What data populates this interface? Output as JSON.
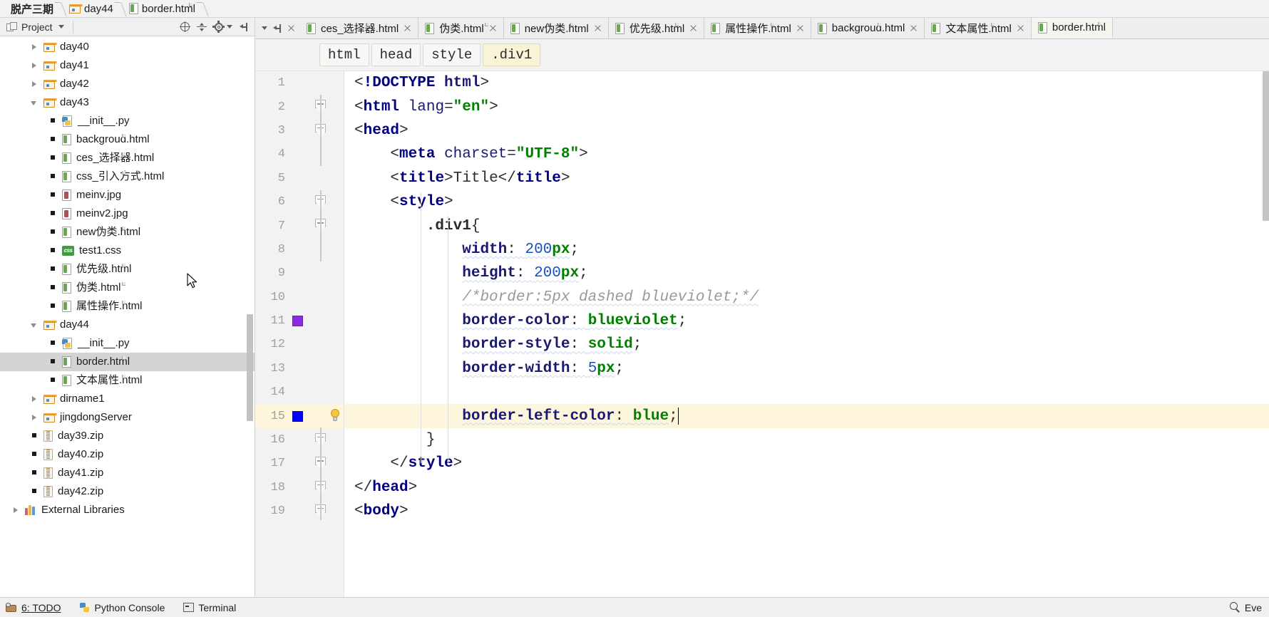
{
  "breadcrumb": {
    "items": [
      {
        "label": "脱产三期",
        "icon": "none",
        "bold": true
      },
      {
        "label": "day44",
        "icon": "folder-icon",
        "bold": false
      },
      {
        "label": "border.html",
        "icon": "html-file-icon",
        "bold": false
      }
    ]
  },
  "tool_window": {
    "title": "Project",
    "icon": "project-view-icon",
    "buttons": [
      {
        "name": "locate-in-tree-button",
        "icon": "target-icon"
      },
      {
        "name": "collapse-all-button",
        "icon": "collapse-all-icon"
      },
      {
        "name": "settings-button",
        "icon": "gear-icon"
      },
      {
        "name": "hide-button",
        "icon": "hide-panel-icon"
      }
    ]
  },
  "tree": {
    "items": [
      {
        "label": "day40",
        "icon": "folder-icon",
        "indent": 1,
        "arrow": "right",
        "selected": false
      },
      {
        "label": "day41",
        "icon": "folder-icon",
        "indent": 1,
        "arrow": "right",
        "selected": false
      },
      {
        "label": "day42",
        "icon": "folder-icon",
        "indent": 1,
        "arrow": "right",
        "selected": false
      },
      {
        "label": "day43",
        "icon": "folder-icon",
        "indent": 1,
        "arrow": "down",
        "selected": false
      },
      {
        "label": "__init__.py",
        "icon": "python-file-icon",
        "indent": 2,
        "arrow": "none",
        "selected": false
      },
      {
        "label": "backgroud.html",
        "icon": "html-file-icon",
        "indent": 2,
        "arrow": "none",
        "selected": false
      },
      {
        "label": "ces_选择器.html",
        "icon": "html-file-icon",
        "indent": 2,
        "arrow": "none",
        "selected": false
      },
      {
        "label": "css_引入方式.html",
        "icon": "html-file-icon",
        "indent": 2,
        "arrow": "none",
        "selected": false
      },
      {
        "label": "meinv.jpg",
        "icon": "image-file-icon",
        "indent": 2,
        "arrow": "none",
        "selected": false
      },
      {
        "label": "meinv2.jpg",
        "icon": "image-file-icon",
        "indent": 2,
        "arrow": "none",
        "selected": false
      },
      {
        "label": "new伪类.html",
        "icon": "html-file-icon",
        "indent": 2,
        "arrow": "none",
        "selected": false
      },
      {
        "label": "test1.css",
        "icon": "css-file-icon",
        "indent": 2,
        "arrow": "none",
        "selected": false
      },
      {
        "label": "优先级.html",
        "icon": "html-file-icon",
        "indent": 2,
        "arrow": "none",
        "selected": false
      },
      {
        "label": "伪类.html",
        "icon": "html-file-icon",
        "indent": 2,
        "arrow": "none",
        "selected": false
      },
      {
        "label": "属性操作.html",
        "icon": "html-file-icon",
        "indent": 2,
        "arrow": "none",
        "selected": false
      },
      {
        "label": "day44",
        "icon": "folder-icon",
        "indent": 1,
        "arrow": "down",
        "selected": false
      },
      {
        "label": "__init__.py",
        "icon": "python-file-icon",
        "indent": 2,
        "arrow": "none",
        "selected": false
      },
      {
        "label": "border.html",
        "icon": "html-file-icon",
        "indent": 2,
        "arrow": "none",
        "selected": true
      },
      {
        "label": "文本属性.html",
        "icon": "html-file-icon",
        "indent": 2,
        "arrow": "none",
        "selected": false
      },
      {
        "label": "dirname1",
        "icon": "folder-icon",
        "indent": 1,
        "arrow": "right",
        "selected": false
      },
      {
        "label": "jingdongServer",
        "icon": "folder-icon",
        "indent": 1,
        "arrow": "right",
        "selected": false
      },
      {
        "label": "day39.zip",
        "icon": "zip-file-icon",
        "indent": 1,
        "arrow": "none",
        "selected": false
      },
      {
        "label": "day40.zip",
        "icon": "zip-file-icon",
        "indent": 1,
        "arrow": "none",
        "selected": false
      },
      {
        "label": "day41.zip",
        "icon": "zip-file-icon",
        "indent": 1,
        "arrow": "none",
        "selected": false
      },
      {
        "label": "day42.zip",
        "icon": "zip-file-icon",
        "indent": 1,
        "arrow": "none",
        "selected": false
      },
      {
        "label": "External Libraries",
        "icon": "library-icon",
        "indent": 0,
        "arrow": "right",
        "selected": false
      }
    ]
  },
  "tabs": [
    {
      "label": "ces_选择器.html",
      "icon": "html-file-icon",
      "active": false
    },
    {
      "label": "伪类.html",
      "icon": "html-file-icon",
      "active": false
    },
    {
      "label": "new伪类.html",
      "icon": "html-file-icon",
      "active": false
    },
    {
      "label": "优先级.html",
      "icon": "html-file-icon",
      "active": false
    },
    {
      "label": "属性操作.html",
      "icon": "html-file-icon",
      "active": false
    },
    {
      "label": "backgroud.html",
      "icon": "html-file-icon",
      "active": false
    },
    {
      "label": "文本属性.html",
      "icon": "html-file-icon",
      "active": false
    },
    {
      "label": "border.html",
      "icon": "html-file-icon",
      "active": true
    }
  ],
  "structure_breadcrumb": [
    {
      "label": "html",
      "selected": false
    },
    {
      "label": "head",
      "selected": false
    },
    {
      "label": "style",
      "selected": false
    },
    {
      "label": ".div1",
      "selected": true
    }
  ],
  "editor": {
    "current_line": 15,
    "gutter_markers": [
      {
        "line": 11,
        "type": "color-swatch",
        "color": "#8A2BE2"
      },
      {
        "line": 15,
        "type": "color-swatch",
        "color": "#0000FF"
      },
      {
        "line": 15,
        "type": "intention-bulb"
      }
    ],
    "lines": [
      {
        "n": 1,
        "text": "<!DOCTYPE html>"
      },
      {
        "n": 2,
        "text": "<html lang=\"en\">"
      },
      {
        "n": 3,
        "text": "<head>"
      },
      {
        "n": 4,
        "text": "    <meta charset=\"UTF-8\">"
      },
      {
        "n": 5,
        "text": "    <title>Title</title>"
      },
      {
        "n": 6,
        "text": "    <style>"
      },
      {
        "n": 7,
        "text": "        .div1{"
      },
      {
        "n": 8,
        "text": "            width: 200px;"
      },
      {
        "n": 9,
        "text": "            height: 200px;"
      },
      {
        "n": 10,
        "text": "            /*border:5px dashed blueviolet;*/"
      },
      {
        "n": 11,
        "text": "            border-color: blueviolet;"
      },
      {
        "n": 12,
        "text": "            border-style: solid;"
      },
      {
        "n": 13,
        "text": "            border-width: 5px;"
      },
      {
        "n": 14,
        "text": ""
      },
      {
        "n": 15,
        "text": "            border-left-color: blue;"
      },
      {
        "n": 16,
        "text": "        }"
      },
      {
        "n": 17,
        "text": "    </style>"
      },
      {
        "n": 18,
        "text": "</head>"
      },
      {
        "n": 19,
        "text": "<body>"
      }
    ]
  },
  "statusbar": {
    "items": [
      {
        "label": "6: TODO",
        "icon": "todo-icon"
      },
      {
        "label": "Python Console",
        "icon": "python-icon"
      },
      {
        "label": "Terminal",
        "icon": "terminal-icon"
      }
    ],
    "right": {
      "label": "Eve",
      "icon": "search-icon"
    }
  },
  "colors": {
    "tag": "#000080",
    "string": "#008000",
    "property": "#191970",
    "number": "#1750C4",
    "comment": "#9A9A9A",
    "current_line_bg": "#FDF6DD",
    "selection_bg": "#D4D4D4",
    "swatch_blueviolet": "#8A2BE2",
    "swatch_blue": "#0000FF"
  }
}
